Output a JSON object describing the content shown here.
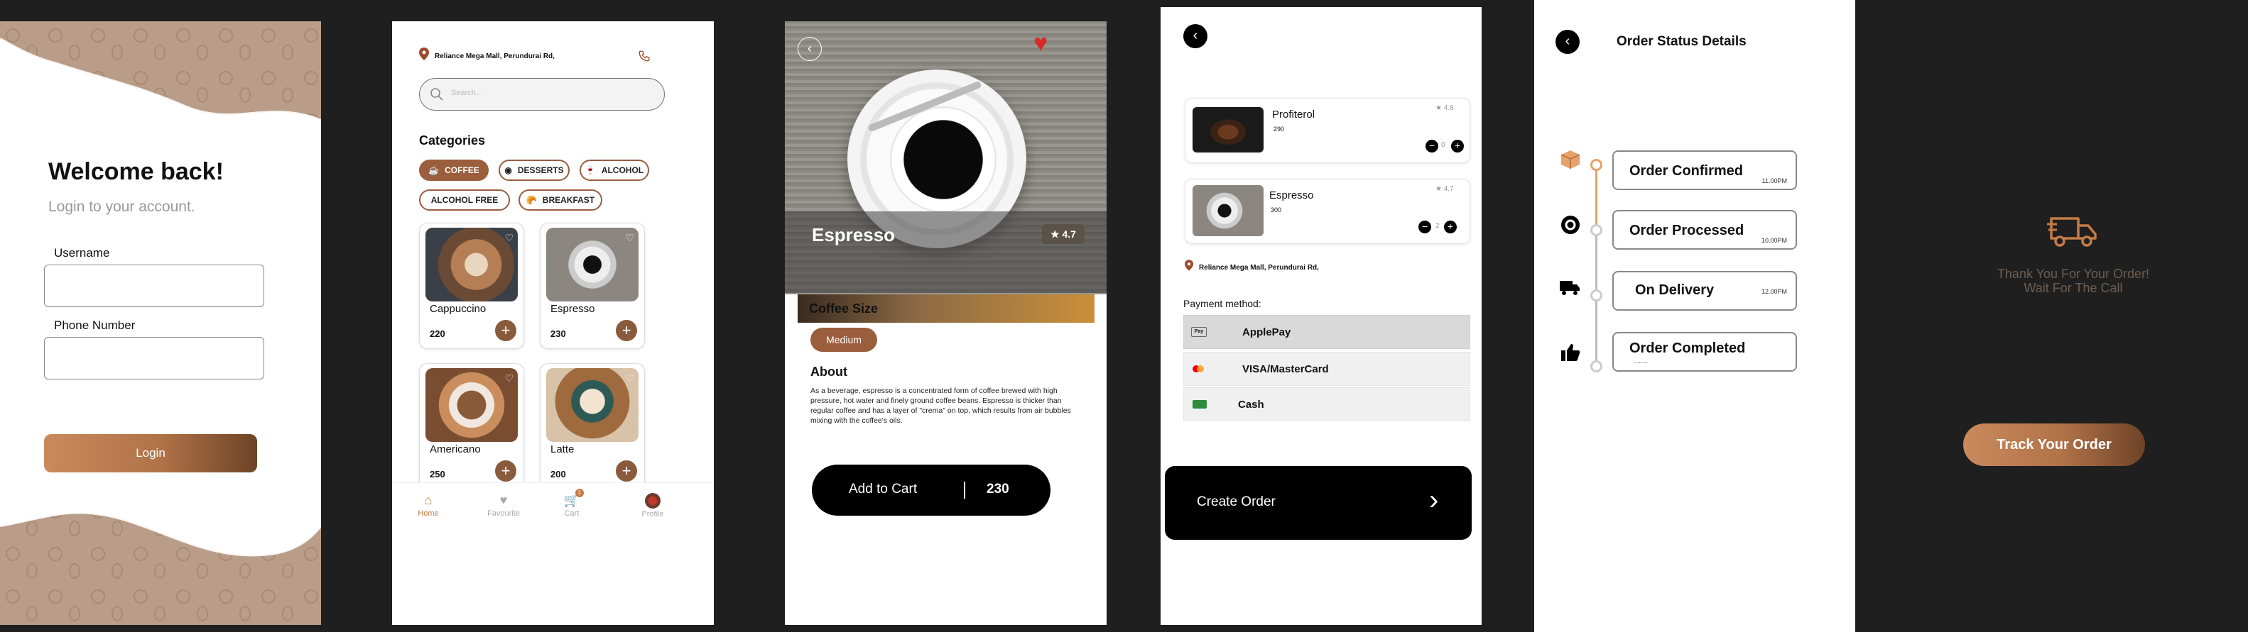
{
  "login": {
    "title": "Welcome back!",
    "subtitle": "Login to your account.",
    "username_label": "Username",
    "phone_label": "Phone Number",
    "login_button": "Login"
  },
  "home": {
    "location": "Reliance Mega Mall, Perundurai Rd,",
    "search_placeholder": "Search...",
    "categories_title": "Categories",
    "categories": [
      "COFFEE",
      "DESSERTS",
      "ALCOHOL",
      "ALCOHOL FREE",
      "BREAKFAST"
    ],
    "products": [
      {
        "name": "Cappuccino",
        "price": "220"
      },
      {
        "name": "Espresso",
        "price": "230"
      },
      {
        "name": "Americano",
        "price": "250"
      },
      {
        "name": "Latte",
        "price": "200"
      }
    ],
    "nav": [
      {
        "label": "Home",
        "icon": "home-icon"
      },
      {
        "label": "Favourite",
        "icon": "heart-icon"
      },
      {
        "label": "Cart",
        "icon": "cart-icon"
      },
      {
        "label": "Profile",
        "icon": "avatar"
      }
    ],
    "cart_badge": "1"
  },
  "detail": {
    "name": "Espresso",
    "rating": "★ 4.7",
    "size_title": "Coffee Size",
    "size_value": "Medium",
    "about_title": "About",
    "about_text": "As a beverage, espresso is a concentrated form of coffee brewed with high pressure, hot water and finely ground coffee beans. Espresso is thicker than regular coffee and has a layer of \"crema\" on top, which results from air bubbles mixing with the coffee's oils.",
    "add_to_cart": "Add to Cart",
    "price": "230"
  },
  "cart": {
    "items": [
      {
        "name": "Profiterol",
        "price": "290",
        "rating": "4.8",
        "qty": "0"
      },
      {
        "name": "Espresso",
        "price": "300",
        "rating": "4.7",
        "qty": "2"
      }
    ],
    "location": "Reliance Mega Mall, Perundurai Rd,",
    "payment_label": "Payment method:",
    "payment_methods": [
      "ApplePay",
      "VISA/MasterCard",
      "Cash"
    ],
    "applepay_badge": "Pay",
    "create_order": "Create Order"
  },
  "status": {
    "title": "Order Status Details",
    "steps": [
      {
        "label": "Order Confirmed",
        "time": "11.00PM"
      },
      {
        "label": "Order Processed",
        "time": "10.00PM"
      },
      {
        "label": "On Delivery",
        "time": "12.00PM"
      },
      {
        "label": "Order Completed",
        "time": "........"
      }
    ]
  },
  "thanks": {
    "line1": "Thank You For Your Order!",
    "line2": "Wait For The Call",
    "track_button": "Track Your Order"
  },
  "colors": {
    "brown": "#9b5e3d",
    "accent": "#c57b47",
    "bg_dark": "#1f1f1f"
  }
}
